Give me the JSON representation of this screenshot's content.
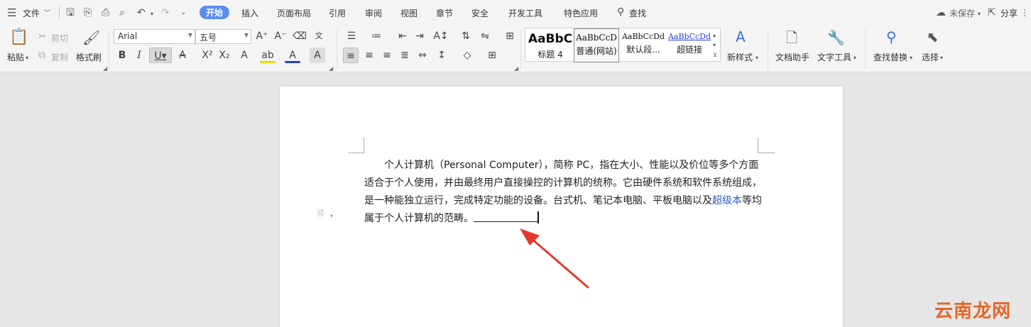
{
  "menubar": {
    "file_label": "文件",
    "tabs": [
      "开始",
      "插入",
      "页面布局",
      "引用",
      "审阅",
      "视图",
      "章节",
      "安全",
      "开发工具",
      "特色应用"
    ],
    "active_tab": "开始",
    "search_label": "查找",
    "sync_label": "未保存",
    "share_label": "分享"
  },
  "ribbon": {
    "clipboard": {
      "paste": "粘贴",
      "cut": "剪切",
      "copy": "复制",
      "format_painter": "格式刷"
    },
    "font": {
      "name": "Arial",
      "size": "五号"
    },
    "styles": [
      {
        "preview": "AaBbC",
        "caption": "标题 4"
      },
      {
        "preview": "AaBbCcD",
        "caption": "普通(网站)"
      },
      {
        "preview": "AaBbCcDd",
        "caption": "默认段..."
      },
      {
        "preview": "AaBbCcDd",
        "caption": "超链接"
      }
    ],
    "new_style": "新样式",
    "doc_assistant": "文档助手",
    "text_tools": "文字工具",
    "find_replace": "查找替换",
    "select": "选择"
  },
  "document": {
    "lines": [
      "个人计算机（Personal Computer），简称 PC，指在大小、性能以及价位等多个方面",
      "适合于个人使用，并由最终用户直接操控的计算机的统称。它由硬件系统和软件系统组成，"
    ],
    "line3_before": "是一种能独立运行，完成特定功能的设备。台式机、笔记本电脑、平板电脑以及",
    "line3_link": "超级本",
    "line3_after": "等均",
    "line4": "属于个人计算机的范畴。"
  },
  "colors": {
    "accent": "#5b8def",
    "arrow": "#e8382d",
    "link": "#2b59c3"
  },
  "watermark": "云南龙网"
}
